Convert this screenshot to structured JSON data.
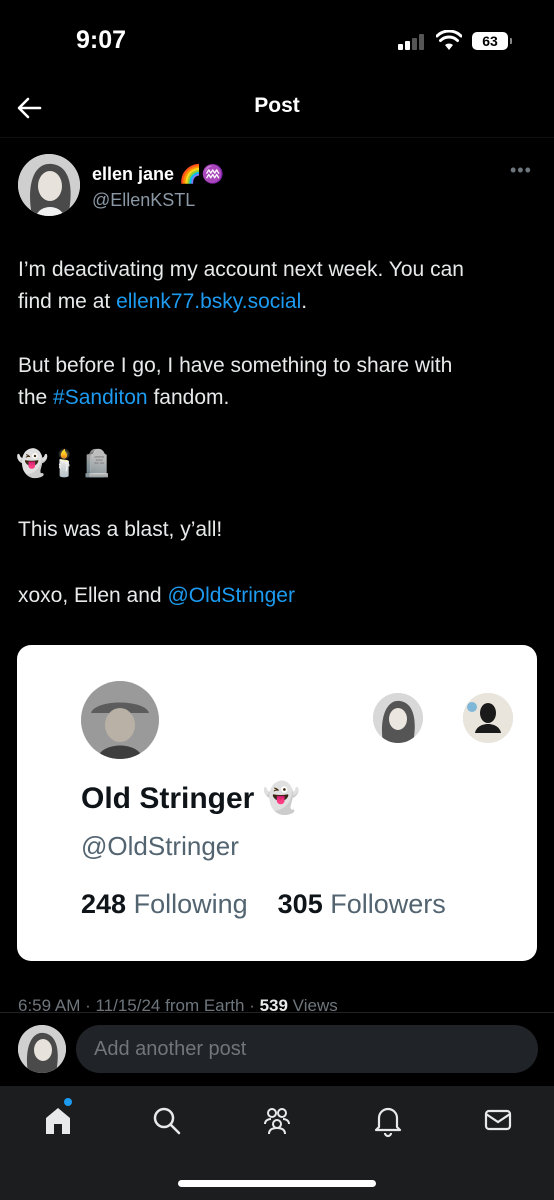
{
  "status_bar": {
    "time": "9:07",
    "battery": "63"
  },
  "header": {
    "title": "Post"
  },
  "post": {
    "author_name": "ellen jane",
    "author_badges": "🌈♒",
    "author_handle": "@EllenKSTL",
    "more": "•••",
    "line1_a": "I’m deactivating my account next week. You can",
    "line1_b_prefix": "find me at ",
    "line1_link": "ellenk77.bsky.social",
    "line1_b_suffix": ".",
    "line2_a": "But before I go, I have something to share with",
    "line2_b_prefix": "the ",
    "line2_hashtag": "#Sanditon",
    "line2_b_suffix": " fandom.",
    "emojis": "👻🕯️🪦",
    "line3": "This was a blast, y’all!",
    "line4_prefix": "xoxo, Ellen and ",
    "line4_mention": "@OldStringer",
    "meta_time": "6:59 AM · 11/15/24 from Earth · ",
    "meta_views_count": "539",
    "meta_views_label": " Views"
  },
  "card": {
    "name": "Old Stringer",
    "name_emoji": "👻",
    "handle": "@OldStringer",
    "following_count": "248",
    "following_label": "Following",
    "followers_count": "305",
    "followers_label": "Followers"
  },
  "reply": {
    "placeholder": "Add another post"
  },
  "nav": [
    "home-icon",
    "search-icon",
    "communities-icon",
    "notifications-icon",
    "messages-icon"
  ],
  "colors": {
    "accent": "#1d9bf0",
    "background": "#000000",
    "card": "#ffffff"
  }
}
